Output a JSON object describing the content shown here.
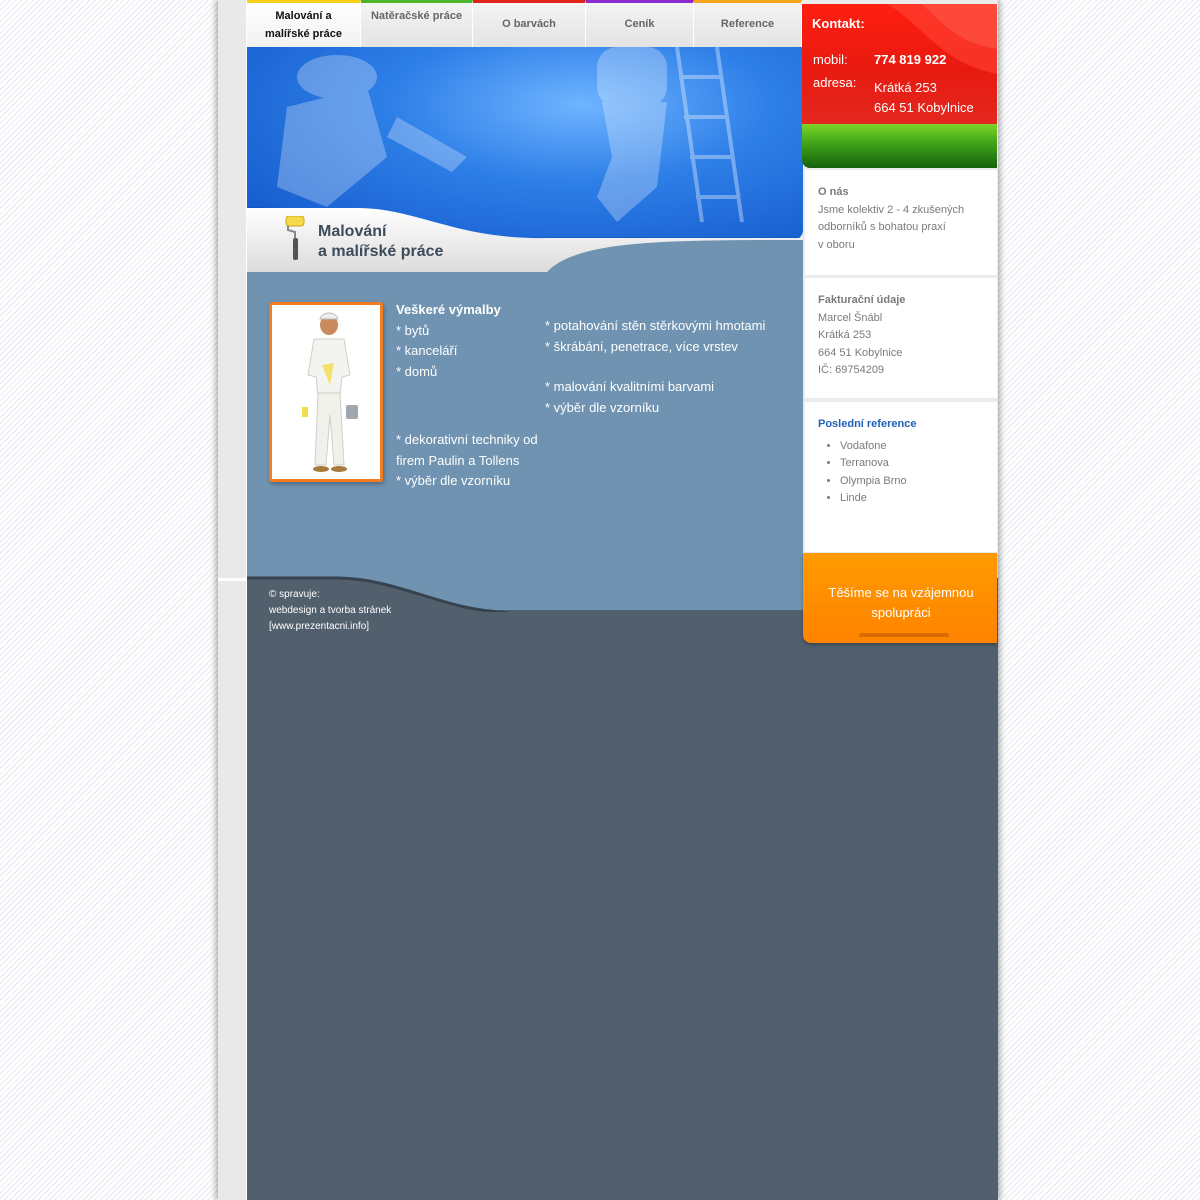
{
  "nav": {
    "items": [
      {
        "line1": "Malování a",
        "line2": "malířské práce",
        "color": "#f7d21a",
        "active": true
      },
      {
        "line1": "Natěračské práce",
        "line2": "",
        "color": "#4cb52c",
        "active": false
      },
      {
        "line1": "O barvách",
        "line2": "",
        "color": "#e0221a",
        "active": false
      },
      {
        "line1": "Ceník",
        "line2": "",
        "color": "#8a2bd0",
        "active": false
      },
      {
        "line1": "Reference",
        "line2": "",
        "color": "#f7a41a",
        "active": false
      }
    ]
  },
  "hero": {
    "title_line1": "Malování",
    "title_line2": "a malířské práce",
    "icon": "paint-roller-icon"
  },
  "content": {
    "col1": {
      "heading": "Veškeré výmalby",
      "items_a": [
        "* bytů",
        "* kanceláří",
        "* domů"
      ],
      "items_b": [
        "* dekorativní techniky od firem Paulin a Tollens",
        "* výběr dle vzorníku"
      ]
    },
    "col2": {
      "items_a": [
        "* potahování stěn stěrkovými hmotami",
        "* škrábání, penetrace, více vrstev"
      ],
      "items_b": [
        "* malování kvalitními barvami",
        "* výběr dle vzorníku"
      ]
    }
  },
  "footer": {
    "line1": "© spravuje:",
    "line2": "webdesign a tvorba stránek",
    "line3": "[www.prezentacni.info]"
  },
  "contact": {
    "title": "Kontakt:",
    "mobile_label": "mobil:",
    "mobile": "774 819 922",
    "address_label": "adresa:",
    "address_line1": "Krátká 253",
    "address_line2": "664 51 Kobylnice"
  },
  "about": {
    "title": "O nás",
    "lines": [
      "Jsme kolektiv 2 - 4 zkušených",
      "odborníků s bohatou praxí",
      "v oboru"
    ]
  },
  "billing": {
    "title": "Fakturační údaje",
    "lines": [
      "Marcel Šnábl",
      "Krátká 253",
      "664 51 Kobylnice",
      "IČ: 69754209"
    ]
  },
  "references": {
    "title": "Poslední reference",
    "items": [
      "Vodafone",
      "Terranova",
      "Olympia Brno",
      "Linde"
    ]
  },
  "banner": {
    "text": "Těšíme se na vzájemnou spolupráci"
  },
  "colors": {
    "accent_orange": "#ff8a00",
    "contact_red": "#e81a10",
    "hero_blue": "#2e7fe8",
    "content_blue": "#6f93b0"
  }
}
